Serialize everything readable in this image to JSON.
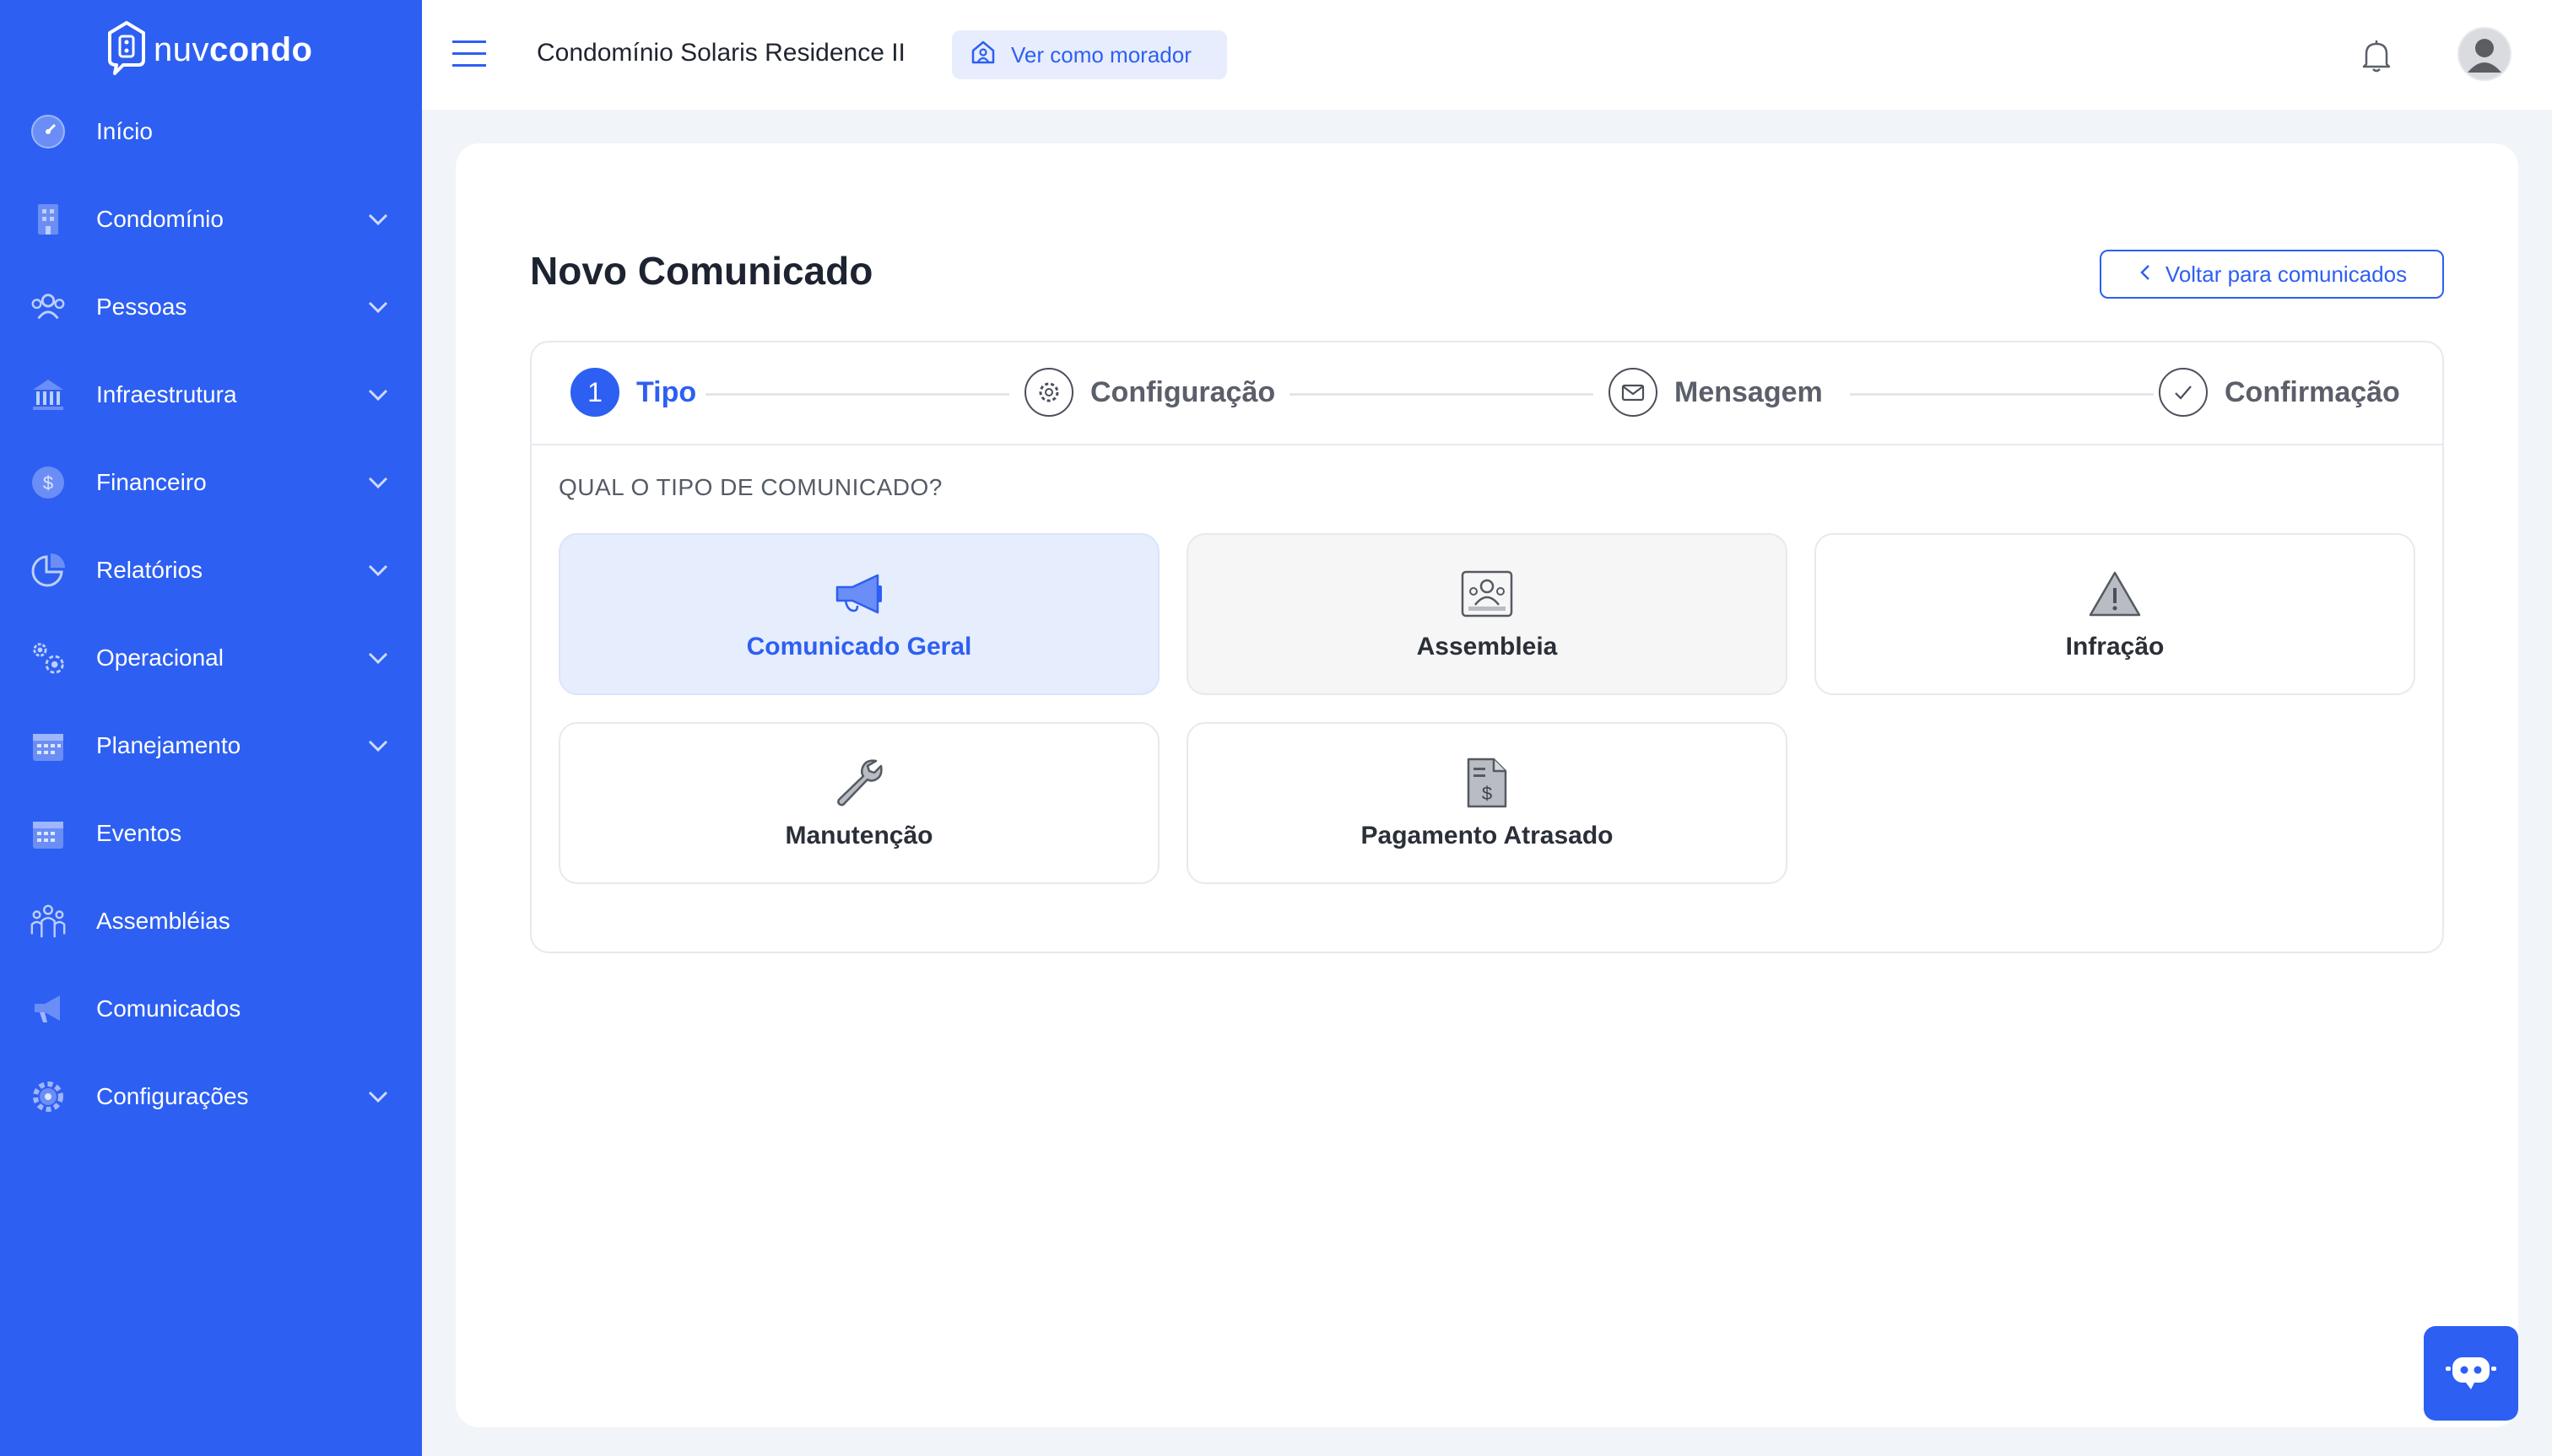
{
  "brand": {
    "prefix": "nuv",
    "suffix": "condo"
  },
  "sidebar": {
    "items": [
      {
        "label": "Início",
        "icon": "dashboard-icon",
        "expandable": false
      },
      {
        "label": "Condomínio",
        "icon": "building-icon",
        "expandable": true
      },
      {
        "label": "Pessoas",
        "icon": "people-icon",
        "expandable": true
      },
      {
        "label": "Infraestrutura",
        "icon": "bank-icon",
        "expandable": true
      },
      {
        "label": "Financeiro",
        "icon": "dollar-icon",
        "expandable": true
      },
      {
        "label": "Relatórios",
        "icon": "pie-chart-icon",
        "expandable": true
      },
      {
        "label": "Operacional",
        "icon": "gears-icon",
        "expandable": true
      },
      {
        "label": "Planejamento",
        "icon": "calendar-icon",
        "expandable": true
      },
      {
        "label": "Eventos",
        "icon": "calendar-grid-icon",
        "expandable": false
      },
      {
        "label": "Assembléias",
        "icon": "assembly-icon",
        "expandable": false
      },
      {
        "label": "Comunicados",
        "icon": "megaphone-icon",
        "expandable": false
      },
      {
        "label": "Configurações",
        "icon": "gear-icon",
        "expandable": true
      }
    ]
  },
  "topbar": {
    "condo_name": "Condomínio Solaris Residence II",
    "view_as_resident": "Ver como morador"
  },
  "page": {
    "title": "Novo Comunicado",
    "back_label": "Voltar para comunicados"
  },
  "wizard": {
    "steps": [
      {
        "number": "1",
        "label": "Tipo",
        "active": true
      },
      {
        "label": "Configuração",
        "icon": "gear-icon"
      },
      {
        "label": "Mensagem",
        "icon": "envelope-icon"
      },
      {
        "label": "Confirmação",
        "icon": "check-icon"
      }
    ],
    "question": "QUAL O TIPO DE COMUNICADO?",
    "options": [
      {
        "label": "Comunicado Geral",
        "icon": "megaphone-icon",
        "state": "selected"
      },
      {
        "label": "Assembleia",
        "icon": "user-frame-icon",
        "state": "hover"
      },
      {
        "label": "Infração",
        "icon": "warning-icon",
        "state": "default"
      },
      {
        "label": "Manutenção",
        "icon": "wrench-icon",
        "state": "default"
      },
      {
        "label": "Pagamento Atrasado",
        "icon": "invoice-icon",
        "state": "default"
      }
    ]
  },
  "colors": {
    "primary": "#2d5ff2",
    "selected_bg": "#e6edfd",
    "page_bg": "#f1f4f9"
  }
}
